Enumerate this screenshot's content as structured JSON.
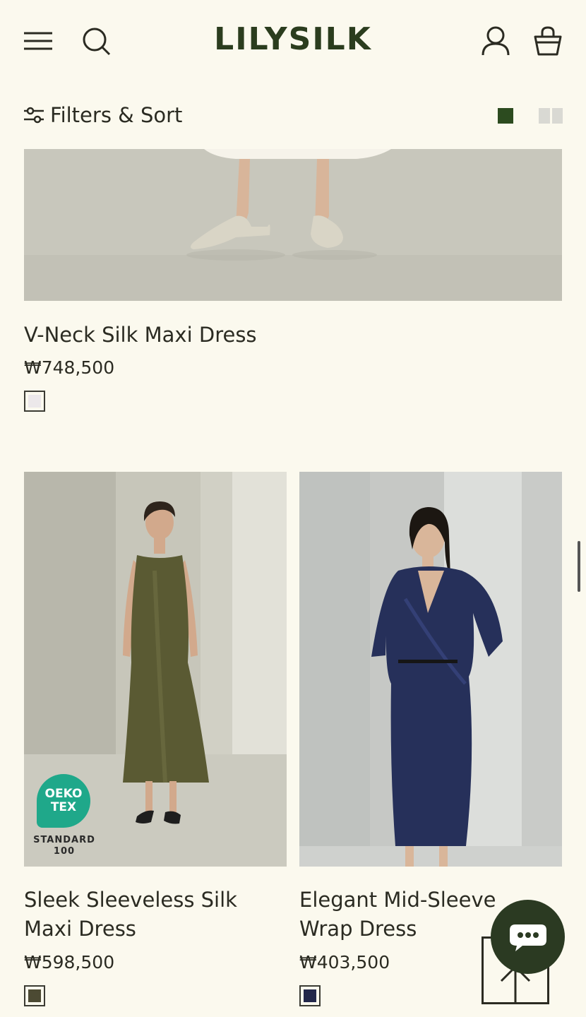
{
  "header": {
    "logo": "LILYSILK",
    "menu_icon": "hamburger-menu-icon",
    "search_icon": "search-icon",
    "account_icon": "user-account-icon",
    "bag_icon": "shopping-bag-icon"
  },
  "toolbar": {
    "filters_label": "Filters & Sort",
    "filters_icon": "sliders-icon",
    "grid_single_active": true,
    "accent_color": "#2c4b1f"
  },
  "products": [
    {
      "title": "V-Neck Silk Maxi Dress",
      "price": "₩748,500",
      "swatch_color": "#ece8ea"
    },
    {
      "title": "Sleek Sleeveless Silk Maxi Dress",
      "price": "₩598,500",
      "swatch_color": "#4c4a33",
      "badge": {
        "line1": "OEKO",
        "line2": "TEX",
        "standard": "STANDARD",
        "number": "100"
      }
    },
    {
      "title": "Elegant Mid-Sleeve Wrap Dress",
      "price": "₩403,500",
      "swatch_color": "#23284a"
    }
  ],
  "floating": {
    "chat_icon": "chat-bubble-icon",
    "back_to_top_icon": "arrow-up-icon"
  }
}
